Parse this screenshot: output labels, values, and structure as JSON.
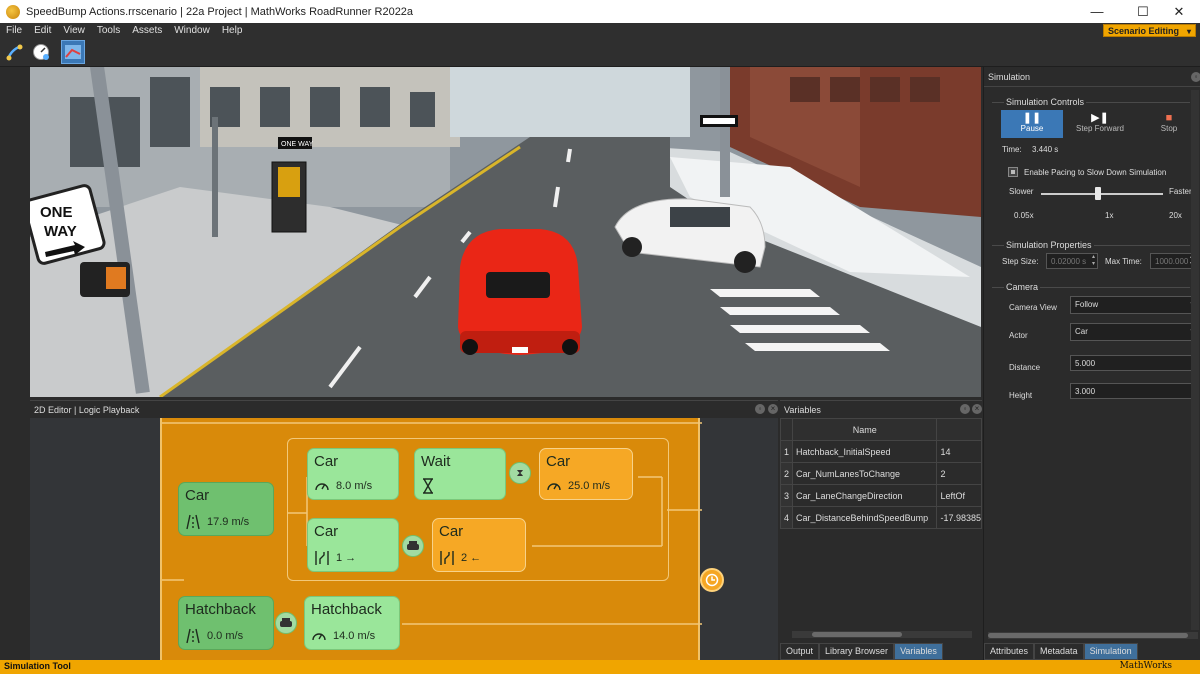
{
  "window": {
    "title": "SpeedBump Actions.rrscenario | 22a Project | MathWorks RoadRunner R2022a",
    "minimize": "—",
    "maximize": "☐",
    "close": "✕"
  },
  "menu": [
    "File",
    "Edit",
    "View",
    "Tools",
    "Assets",
    "Window",
    "Help"
  ],
  "mode": {
    "label": "Scenario Editing",
    "arrow": "▾"
  },
  "toolbar": {
    "tools": [
      "path-tool-icon",
      "speedometer-tool-icon",
      "scenario-tool-icon"
    ],
    "active_index": 2
  },
  "viewport": {
    "signs": {
      "one_way_large_1": "ONE",
      "one_way_large_2": "WAY",
      "one_way_small": "ONE WAY"
    }
  },
  "editor": {
    "title": "2D Editor | Logic Playback",
    "nodes": {
      "car_start": {
        "label": "Car",
        "value": "17.9 m/s"
      },
      "car_speed": {
        "label": "Car",
        "value": "8.0 m/s"
      },
      "wait": {
        "label": "Wait"
      },
      "car_speed2": {
        "label": "Car",
        "value": "25.0 m/s"
      },
      "car_lane": {
        "label": "Car",
        "value": "1 →"
      },
      "car_lane2": {
        "label": "Car",
        "value": "2 ←"
      },
      "hatch_start": {
        "label": "Hatchback",
        "value": "0.0 m/s"
      },
      "hatch_speed": {
        "label": "Hatchback",
        "value": "14.0 m/s"
      }
    }
  },
  "variables": {
    "title": "Variables",
    "column": "Name",
    "rows": [
      {
        "index": "1",
        "name": "Hatchback_InitialSpeed",
        "value": "14"
      },
      {
        "index": "2",
        "name": "Car_NumLanesToChange",
        "value": "2"
      },
      {
        "index": "3",
        "name": "Car_LaneChangeDirection",
        "value": "LeftOf"
      },
      {
        "index": "4",
        "name": "Car_DistanceBehindSpeedBump",
        "value": "-17.98385"
      }
    ],
    "tabs": [
      "Output",
      "Library Browser",
      "Variables"
    ],
    "active_tab": "Variables"
  },
  "simulation": {
    "title": "Simulation",
    "controls_title": "Simulation Controls",
    "pause": "Pause",
    "step_forward": "Step Forward",
    "stop": "Stop",
    "time_label": "Time:",
    "time_value": "3.440 s",
    "pacing_label": "Enable Pacing to Slow Down Simulation",
    "slower": "Slower",
    "faster": "Faster",
    "ticks": [
      "0.05x",
      "1x",
      "20x"
    ],
    "pacing_fraction": 0.47,
    "properties_title": "Simulation Properties",
    "step_size_label": "Step Size:",
    "step_size_value": "0.02000 s",
    "max_time_label": "Max Time:",
    "max_time_value": "1000.000",
    "camera_title": "Camera",
    "camera_view_label": "Camera View",
    "camera_view_value": "Follow",
    "actor_label": "Actor",
    "actor_value": "Car",
    "distance_label": "Distance",
    "distance_value": "5.000",
    "height_label": "Height",
    "height_value": "3.000",
    "tabs": [
      "Attributes",
      "Metadata",
      "Simulation"
    ],
    "active_tab": "Simulation"
  },
  "status": {
    "left": "Simulation Tool",
    "right": "MathWorks"
  }
}
